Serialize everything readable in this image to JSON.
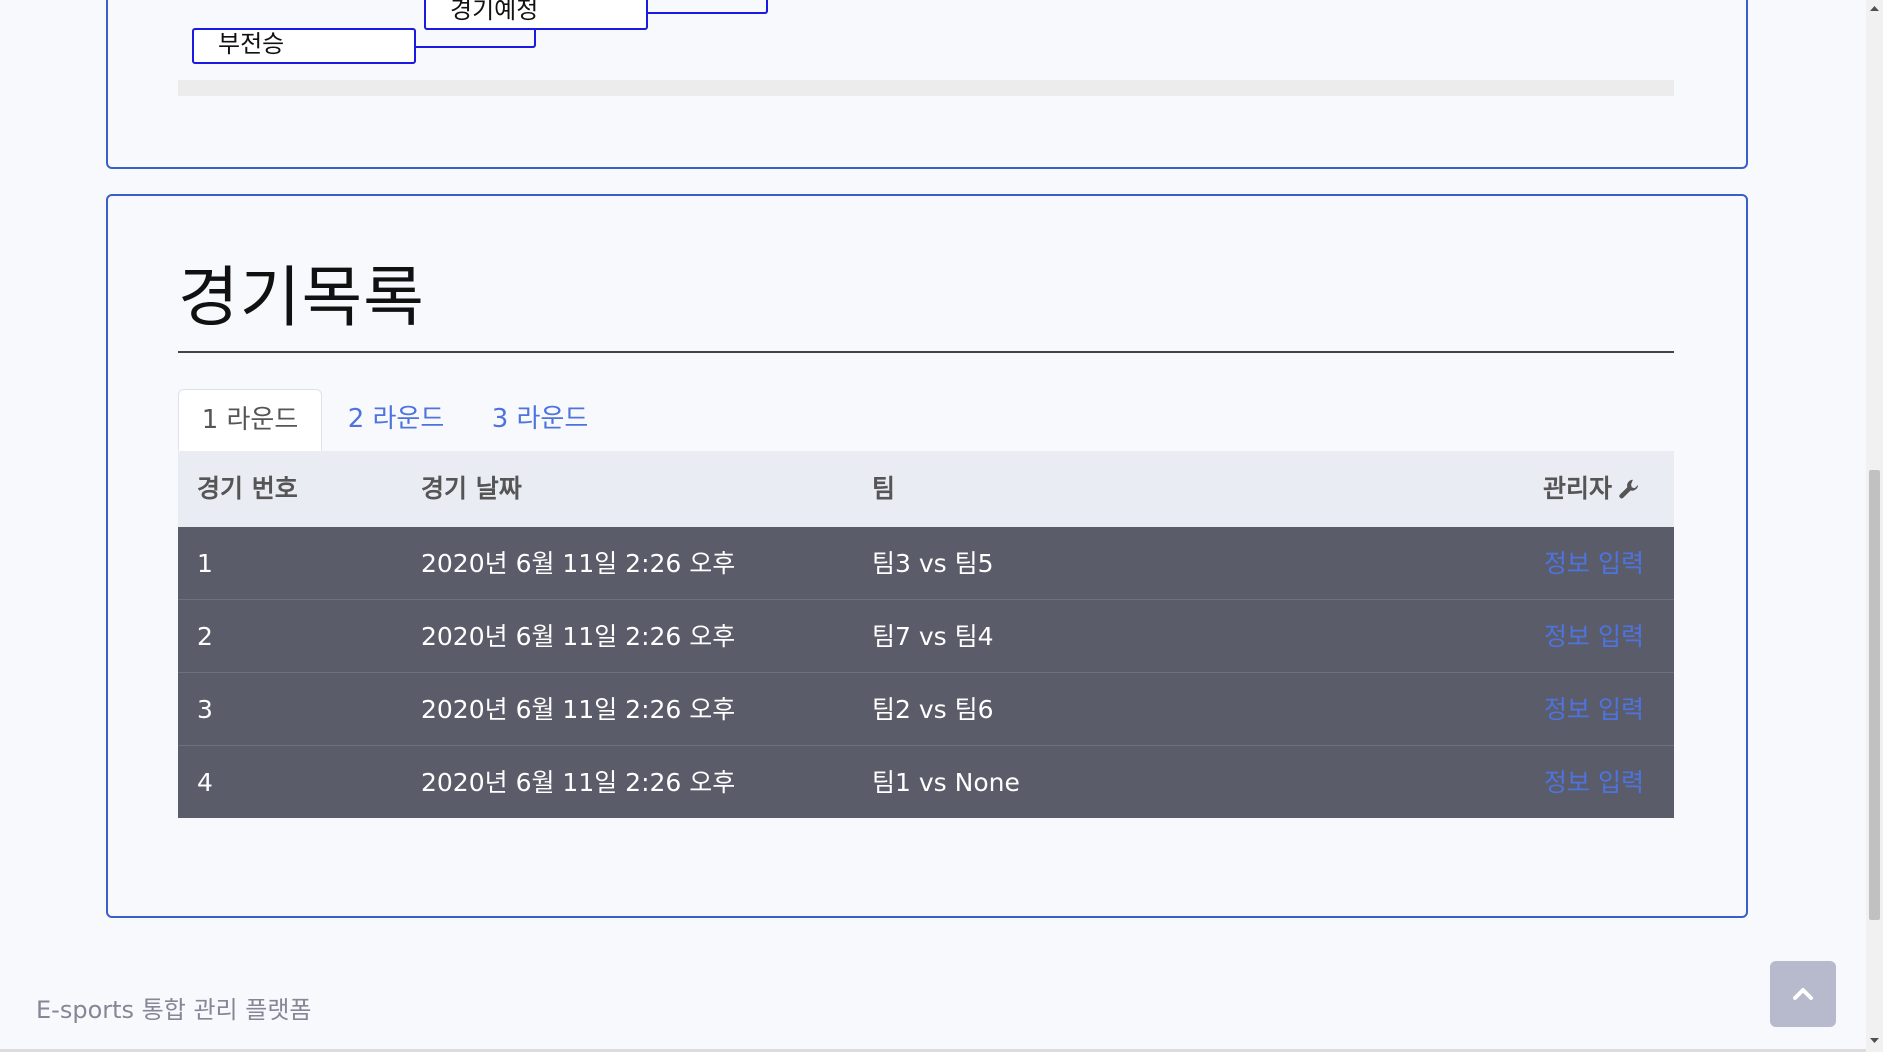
{
  "bracket": {
    "box_upper": "경기예정",
    "box_lower": "부전승"
  },
  "matches": {
    "heading": "경기목록",
    "tabs": [
      "1 라운드",
      "2 라운드",
      "3 라운드"
    ],
    "active_tab": 0,
    "columns": [
      "경기 번호",
      "경기 날짜",
      "팀",
      "관리자"
    ],
    "rows": [
      {
        "no": "1",
        "date": "2020년 6월 11일 2:26 오후",
        "teams": "팀3 vs 팀5",
        "action": "정보 입력"
      },
      {
        "no": "2",
        "date": "2020년 6월 11일 2:26 오후",
        "teams": "팀7 vs 팀4",
        "action": "정보 입력"
      },
      {
        "no": "3",
        "date": "2020년 6월 11일 2:26 오후",
        "teams": "팀2 vs 팀6",
        "action": "정보 입력"
      },
      {
        "no": "4",
        "date": "2020년 6월 11일 2:26 오후",
        "teams": "팀1 vs None",
        "action": "정보 입력"
      }
    ]
  },
  "footer": {
    "brand": "E-sports 통합 관리 플랫폼"
  },
  "icons": {
    "admin": "wrench-icon",
    "scroll_top": "chevron-up-icon"
  },
  "colors": {
    "accent": "#4e73df",
    "card_border": "#3b5fc8",
    "row_bg": "#5a5c69",
    "header_bg": "#e9ecf3"
  }
}
